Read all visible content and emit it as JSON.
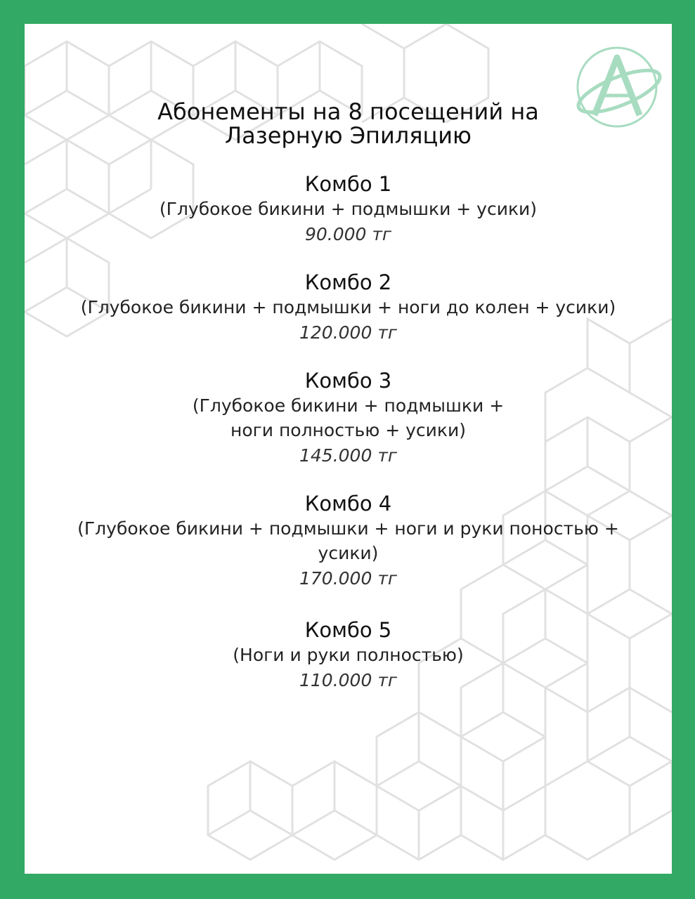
{
  "title": {
    "line1": "Абонементы на 8 посещений на",
    "line2": "Лазерную Эпиляцию"
  },
  "logo": {
    "letter": "A",
    "icon": "brand-logo-a-orbit-icon",
    "color": "#a8dcc1"
  },
  "colors": {
    "border": "#32aa65",
    "background": "#ffffff",
    "pattern": "#d9d9d9"
  },
  "combos": [
    {
      "name": "Комбо 1",
      "desc": [
        "(Глубокое бикини + подмышки + усики)"
      ],
      "price": "90.000 тг"
    },
    {
      "name": "Комбо 2",
      "desc": [
        "(Глубокое бикини + подмышки + ноги до колен + усики)"
      ],
      "price": "120.000 тг"
    },
    {
      "name": "Комбо 3",
      "desc": [
        "(Глубокое бикини + подмышки +",
        "ноги полностью + усики)"
      ],
      "price": "145.000 тг"
    },
    {
      "name": "Комбо 4",
      "desc": [
        "(Глубокое бикини + подмышки + ноги и руки поностью +",
        "усики)"
      ],
      "price": "170.000 тг"
    },
    {
      "name": "Комбо 5",
      "desc": [
        "(Ноги и руки полностью)"
      ],
      "price": "110.000 тг"
    }
  ]
}
